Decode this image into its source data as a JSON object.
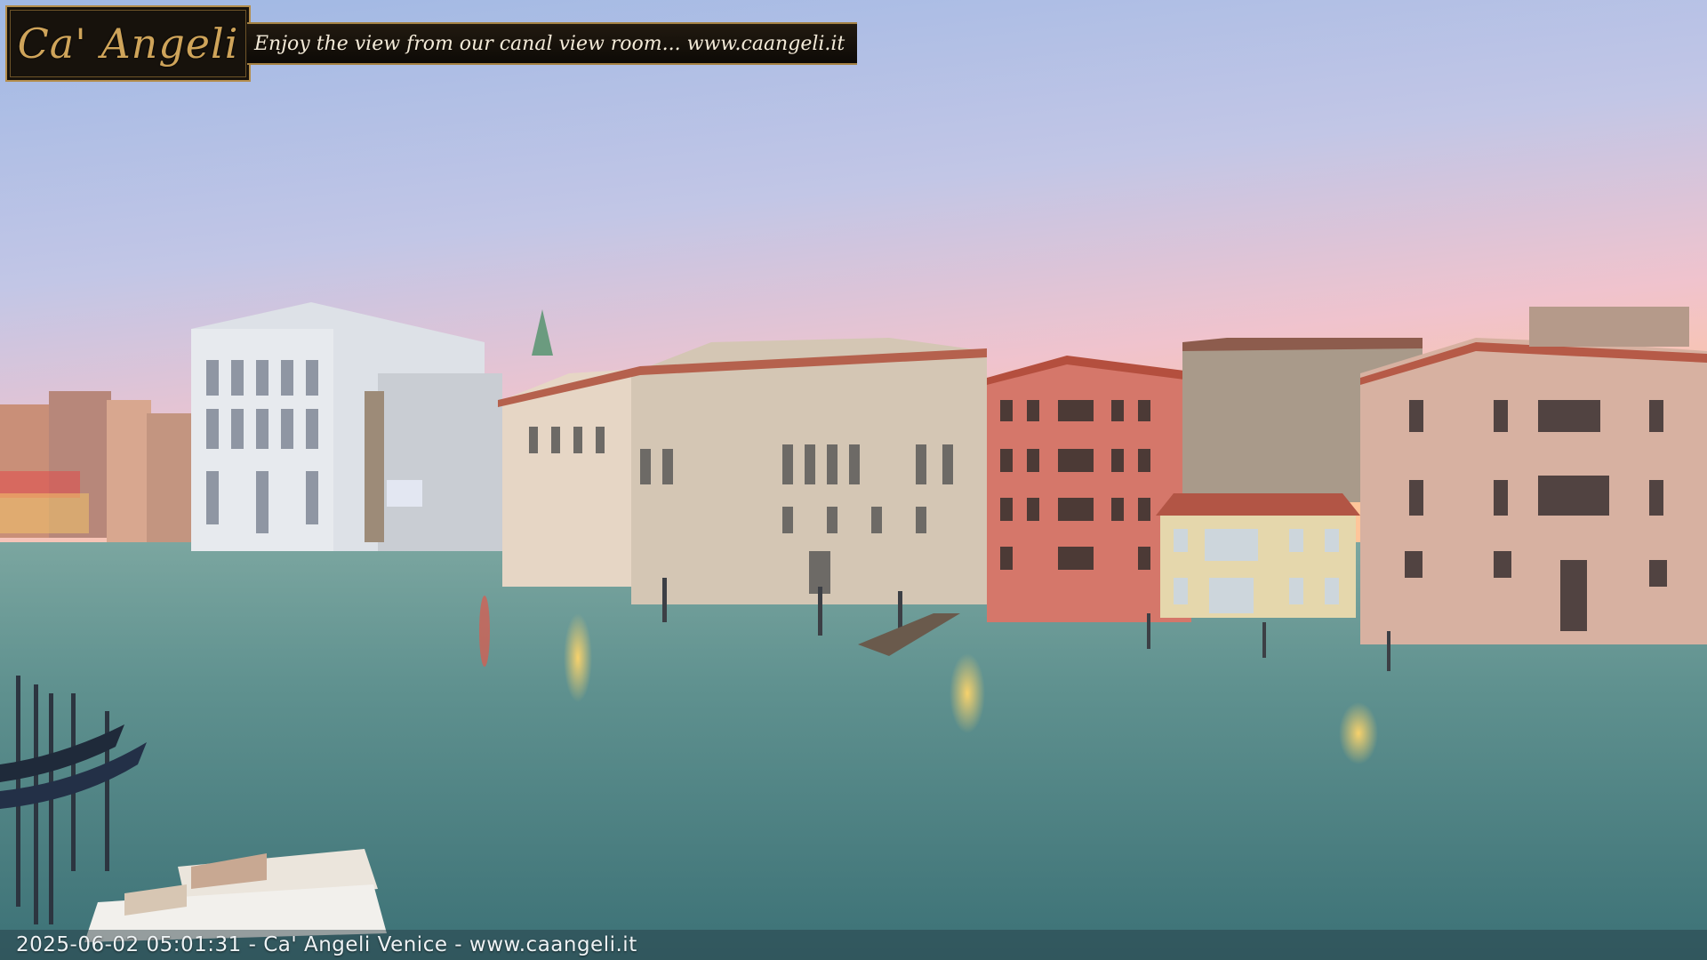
{
  "overlay": {
    "logo_text": "Ca' Angeli",
    "tagline": "Enjoy the view from our canal view room... www.caangeli.it",
    "timestamp": "2025-06-02 05:01:31 - Ca' Angeli Venice - www.caangeli.it"
  },
  "scene": {
    "description_icons": [
      "grand-canal-scene"
    ],
    "colors": {
      "sky_top": "#aac0e6",
      "sky_horizon": "#f1c6c6",
      "sky_sunrise": "#ffc89a",
      "water_top": "#6e9d98",
      "water_bottom": "#3e7378",
      "logo_gold": "#cfa45a"
    }
  }
}
